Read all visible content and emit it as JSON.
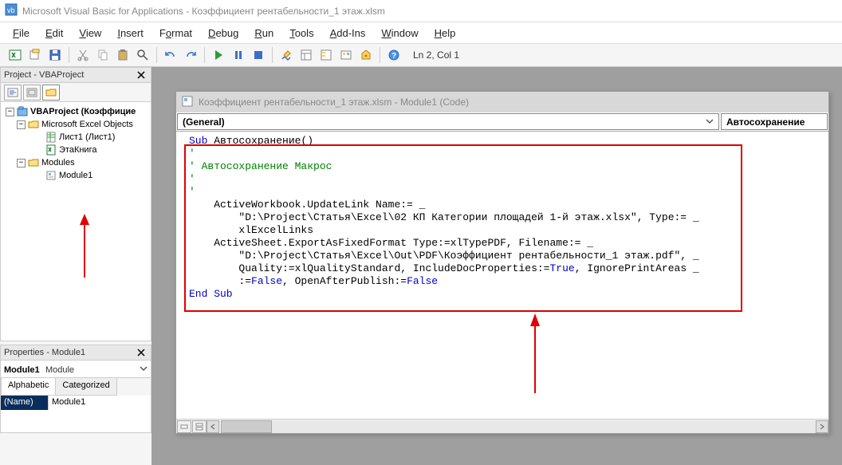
{
  "title": "Microsoft Visual Basic for Applications - Коэффициент рентабельности_1 этаж.xlsm",
  "menu": {
    "file": "File",
    "edit": "Edit",
    "view": "View",
    "insert": "Insert",
    "format": "Format",
    "debug": "Debug",
    "run": "Run",
    "tools": "Tools",
    "addins": "Add-Ins",
    "window": "Window",
    "help": "Help"
  },
  "toolbar": {
    "position": "Ln 2, Col 1"
  },
  "project_panel": {
    "title": "Project - VBAProject",
    "tree": {
      "root": "VBAProject (Коэффицие",
      "excel_objects": "Microsoft Excel Objects",
      "sheet1": "Лист1 (Лист1)",
      "thisbook": "ЭтаКнига",
      "modules": "Modules",
      "module1": "Module1"
    }
  },
  "properties_panel": {
    "title": "Properties - Module1",
    "object_name": "Module1",
    "object_type": "Module",
    "tab_alpha": "Alphabetic",
    "tab_cat": "Categorized",
    "prop_name_key": "(Name)",
    "prop_name_val": "Module1"
  },
  "code_window": {
    "title": "Коэффициент рентабельности_1 этаж.xlsm - Module1 (Code)",
    "dd_left": "(General)",
    "dd_right": "Автосохранение",
    "lines": {
      "l1a": "Sub",
      "l1b": " Автосохранение()",
      "l2": "'",
      "l3": "' Автосохранение Макрос",
      "l4": "'",
      "l5": "",
      "l6": "'",
      "l7": "    ActiveWorkbook.UpdateLink Name:= _",
      "l8": "        \"D:\\Project\\Статья\\Excel\\02 КП Категории площадей 1-й этаж.xlsx\", Type:= _",
      "l9": "        xlExcelLinks",
      "l10": "    ActiveSheet.ExportAsFixedFormat Type:=xlTypePDF, Filename:= _",
      "l11": "        \"D:\\Project\\Статья\\Excel\\Out\\PDF\\Коэффициент рентабельности_1 этаж.pdf\", _",
      "l12": "        Quality:=xlQualityStandard, IncludeDocProperties:=",
      "l12t": "True",
      "l12b": ", IgnorePrintAreas _",
      "l13a": "        :=",
      "l13f1": "False",
      "l13b": ", OpenAfterPublish:=",
      "l13f2": "False",
      "l14": "End Sub"
    }
  }
}
